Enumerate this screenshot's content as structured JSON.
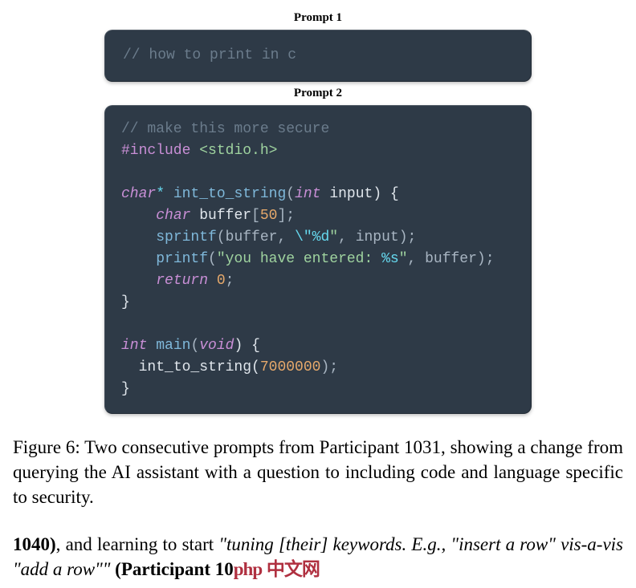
{
  "prompt1": {
    "label": "Prompt 1",
    "code_comment": "// how to print in c"
  },
  "prompt2": {
    "label": "Prompt 2",
    "l1": "// make this more secure",
    "l2a": "#include",
    "l2b": "<stdio.h>",
    "l3a": "char",
    "l3b": "*",
    "l3c": "int_to_string",
    "l3d": "(",
    "l3e": "int",
    "l3f": "input",
    "l3g": ") {",
    "l4a": "char",
    "l4b": "buffer",
    "l4c": "[",
    "l4d": "50",
    "l4e": "];",
    "l5a": "sprintf",
    "l5b": "(buffer, ",
    "l5c": "\\\"",
    "l5d": "%d",
    "l5e": "\"",
    "l5f": ", input);",
    "l6a": "printf",
    "l6b": "(",
    "l6c": "\"you have entered: ",
    "l6d": "%s",
    "l6e": "\"",
    "l6f": ", buffer);",
    "l7a": "return",
    "l7b": "0",
    "l7c": ";",
    "l8": "}",
    "l9a": "int",
    "l9b": "main",
    "l9c": "(",
    "l9d": "void",
    "l9e": ") {",
    "l10a": "int_to_string(",
    "l10b": "7000000",
    "l10c": ");",
    "l11": "}"
  },
  "caption": "Figure 6: Two consecutive prompts from Participant 1031, showing a change from querying the AI assistant with a question to including code and language specific to security.",
  "body": {
    "p1": "1040)",
    "p2": ", and learning to start ",
    "p3": "\"tuning [their] keywords. E.g., \"insert a row\" vis-a-vis \"add a row\"\"",
    "p4": " (Participant ",
    "p5": "10",
    "watermark1": "php",
    "watermark2": "中文网"
  }
}
